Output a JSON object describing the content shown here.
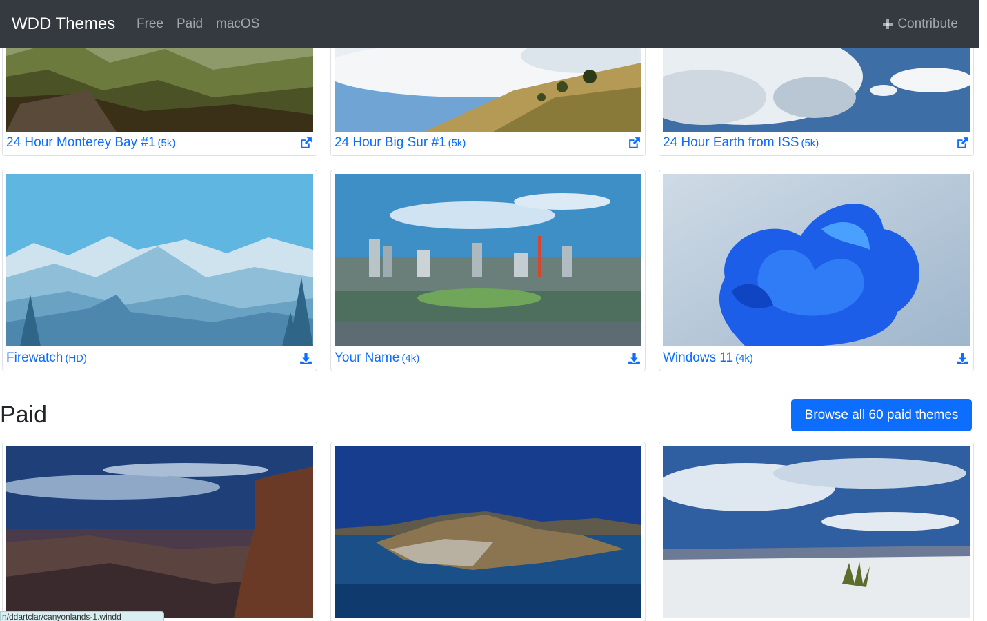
{
  "navbar": {
    "brand": "WDD Themes",
    "links": [
      "Free",
      "Paid",
      "macOS"
    ],
    "contribute": "Contribute"
  },
  "free_themes": [
    {
      "title": "24 Hour Monterey Bay #1",
      "resolution": "(5k)",
      "icon": "external-link-icon"
    },
    {
      "title": "24 Hour Big Sur #1",
      "resolution": "(5k)",
      "icon": "external-link-icon"
    },
    {
      "title": "24 Hour Earth from ISS",
      "resolution": "(5k)",
      "icon": "external-link-icon"
    },
    {
      "title": "Firewatch",
      "resolution": "(HD)",
      "icon": "download-icon"
    },
    {
      "title": "Your Name",
      "resolution": "(4k)",
      "icon": "download-icon"
    },
    {
      "title": "Windows 11",
      "resolution": "(4k)",
      "icon": "download-icon"
    }
  ],
  "paid_section": {
    "heading": "Paid",
    "browse_button": "Browse all 60 paid themes"
  },
  "status_bar": "n/ddartclar/canyonlands-1.windd",
  "colors": {
    "navbar": "#343a40",
    "link": "#0d6efd",
    "button": "#0d6efd"
  }
}
